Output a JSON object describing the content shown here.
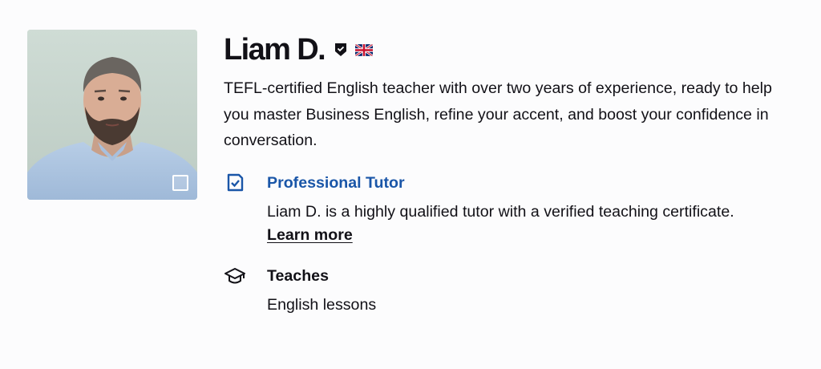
{
  "tutor": {
    "name": "Liam D.",
    "bio": "TEFL-certified English teacher with over two years of experience, ready to help you master Business English, refine your accent, and boost your confidence in conversation.",
    "badge_icon": "shield-badge-icon",
    "flag_icon": "uk-flag-icon"
  },
  "professional": {
    "icon": "certificate-check-icon",
    "title": "Professional Tutor",
    "description": "Liam D. is a highly qualified tutor with a verified teaching certificate.",
    "learn_more": "Learn more"
  },
  "teaches": {
    "icon": "graduation-cap-icon",
    "title": "Teaches",
    "value": "English lessons"
  },
  "colors": {
    "accent_blue": "#1a56a8",
    "text": "#121117"
  }
}
